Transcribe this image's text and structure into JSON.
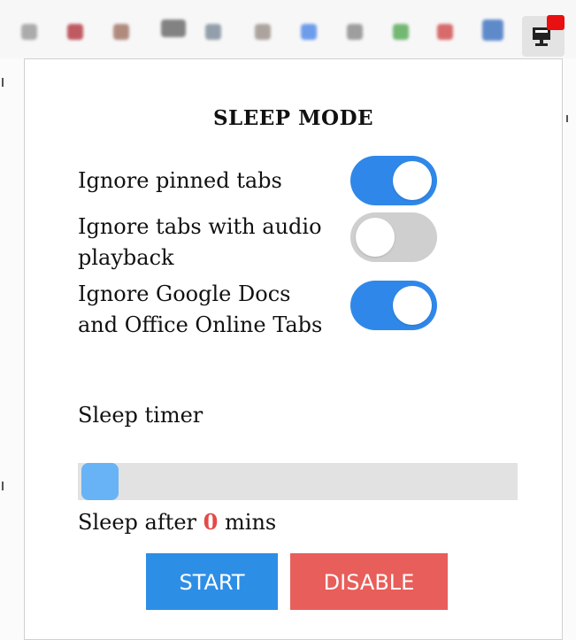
{
  "toolbar": {
    "icons": [
      "extension-icon-1",
      "extension-icon-2",
      "extension-icon-3",
      "extension-icon-4",
      "extension-icon-5",
      "extension-icon-6",
      "extension-icon-7",
      "extension-icon-8",
      "extension-icon-9",
      "extension-icon-10",
      "extension-icon-11",
      "extension-icon-12"
    ],
    "active_extension_icon": "sleep-monitor-icon",
    "badge_color": "#e81010"
  },
  "popup": {
    "title": "SLEEP MODE",
    "options": [
      {
        "label": "Ignore pinned tabs",
        "enabled": true
      },
      {
        "label": "Ignore tabs with audio playback",
        "enabled": false
      },
      {
        "label": "Ignore Google Docs and Office Online Tabs",
        "enabled": true
      }
    ],
    "timer_label": "Sleep timer",
    "slider_value": 0,
    "sleep_after_prefix": "Sleep after",
    "sleep_after_value": "0",
    "sleep_after_suffix": "mins",
    "start_label": "START",
    "disable_label": "DISABLE",
    "colors": {
      "toggle_on": "#2f88e9",
      "toggle_off": "#cfcfcf",
      "slider_thumb": "#68b3f5",
      "start_button": "#2d8ee6",
      "disable_button": "#e85e5a",
      "value_highlight": "#e34a47"
    }
  }
}
